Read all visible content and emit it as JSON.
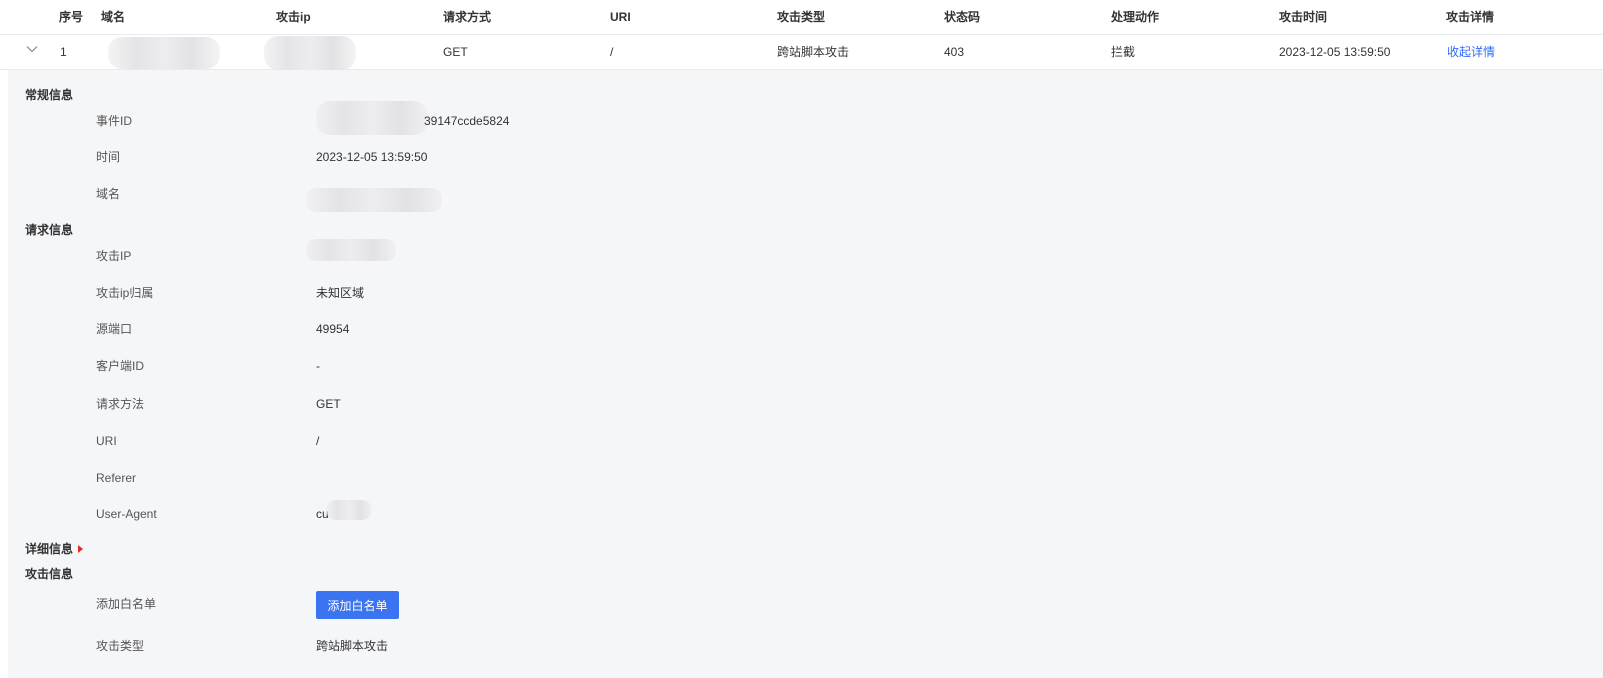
{
  "table": {
    "headers": {
      "index": "序号",
      "domain": "域名",
      "attack_ip": "攻击ip",
      "method": "请求方式",
      "uri": "URI",
      "attack_type": "攻击类型",
      "status_code": "状态码",
      "action": "处理动作",
      "attack_time": "攻击时间",
      "detail": "攻击详情"
    },
    "row": {
      "index": "1",
      "domain": "",
      "attack_ip": "",
      "method": "GET",
      "uri": "/",
      "attack_type": "跨站脚本攻击",
      "status_code": "403",
      "action": "拦截",
      "attack_time": "2023-12-05 13:59:50",
      "toggle_label": "收起详情"
    }
  },
  "detail": {
    "general": {
      "title": "常规信息",
      "event_id_label": "事件ID",
      "event_id_value": "39147ccde5824",
      "time_label": "时间",
      "time_value": "2023-12-05 13:59:50",
      "domain_label": "域名",
      "domain_value": ""
    },
    "request": {
      "title": "请求信息",
      "attack_ip_label": "攻击IP",
      "attack_ip_value": "",
      "ip_region_label": "攻击ip归属",
      "ip_region_value": "未知区域",
      "src_port_label": "源端口",
      "src_port_value": "49954",
      "client_id_label": "客户端ID",
      "client_id_value": "-",
      "method_label": "请求方法",
      "method_value": "GET",
      "uri_label": "URI",
      "uri_value": "/",
      "referer_label": "Referer",
      "referer_value": "",
      "ua_label": "User-Agent",
      "ua_value": "cu"
    },
    "more": {
      "title": "详细信息"
    },
    "attack": {
      "title": "攻击信息",
      "whitelist_label": "添加白名单",
      "whitelist_button": "添加白名单",
      "type_label": "攻击类型",
      "type_value": "跨站脚本攻击"
    }
  },
  "colors": {
    "accent": "#3b74f0",
    "link": "#2f6bff",
    "panel_bg": "#f5f6f8",
    "marker": "#e02b2b"
  },
  "icons": {
    "row_toggle": "chevron-down-icon",
    "more_marker": "caret-right-icon"
  }
}
